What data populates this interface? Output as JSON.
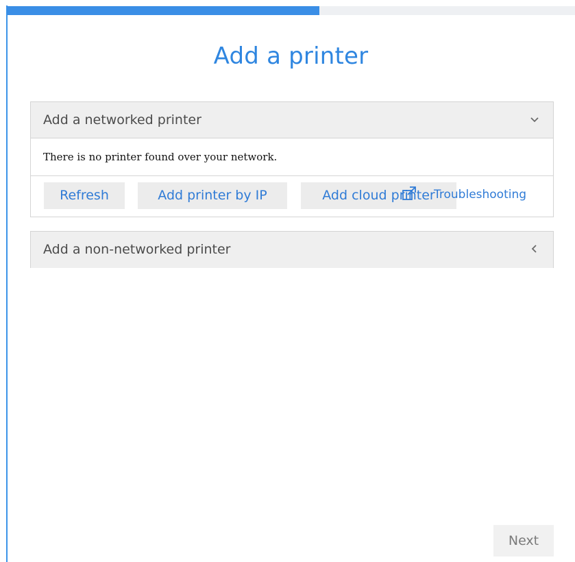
{
  "wizard": {
    "progress": 0.55,
    "title": "Add a printer"
  },
  "networked": {
    "header": "Add a networked printer",
    "expanded": true,
    "chevron_icon": "chevron-down-icon",
    "message": "There is no printer found over your network.",
    "buttons": {
      "refresh": "Refresh",
      "add_by_ip": "Add printer by IP",
      "add_cloud": "Add cloud printer"
    },
    "troubleshooting": {
      "label": "Troubleshooting",
      "icon": "external-link-icon"
    }
  },
  "non_networked": {
    "header": "Add a non-networked printer",
    "expanded": false,
    "chevron_icon": "chevron-left-icon"
  },
  "footer": {
    "next_label": "Next"
  },
  "colors": {
    "accent": "#2f86e0",
    "link": "#2f7bd6",
    "progress_fill": "#3a8ee6",
    "panel_header_bg": "#efefef",
    "button_bg": "#ececec"
  }
}
